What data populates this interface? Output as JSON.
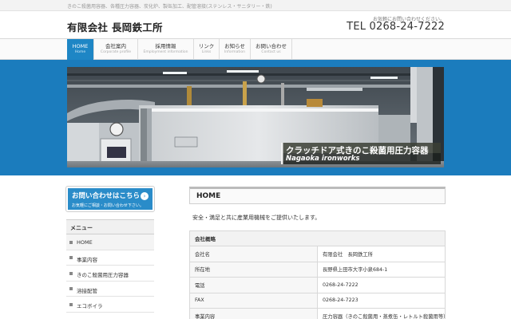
{
  "topbar": {
    "tagline": "きのこ殺菌用容器、各種圧力容器、炭化炉、製缶加工、配管溶接(ステンレス・サニタリー・鉄)"
  },
  "header": {
    "site_title": "有限会社 長岡鉄工所",
    "contact_note": "お気軽にお問い合わせください。",
    "phone": "TEL 0268-24-7222"
  },
  "nav": [
    {
      "jp": "HOME",
      "en": "Home",
      "active": true
    },
    {
      "jp": "会社案内",
      "en": "Corporate profile"
    },
    {
      "jp": "採用情報",
      "en": "Employment information"
    },
    {
      "jp": "リンク",
      "en": "Links"
    },
    {
      "jp": "お知らせ",
      "en": "Information"
    },
    {
      "jp": "お問い合わせ",
      "en": "Contact us"
    }
  ],
  "hero": {
    "caption_jp": "クラッチドア式きのこ殺菌用圧力容器",
    "caption_en": "Nagaoka ironworks"
  },
  "sidebar": {
    "contact_title": "お問い合わせはこちら",
    "contact_sub": "お気軽にご相談・お問い合わせ下さい。",
    "menu_title": "メニュー",
    "menu_items": [
      "HOME",
      "事業内容",
      "きのこ殺菌用圧力容器",
      "溶接配管",
      "エコボイラ"
    ]
  },
  "main": {
    "heading": "HOME",
    "intro": "安全・満足と共に産業用機械をご提供いたします。",
    "table_caption": "会社概略",
    "rows": [
      {
        "label": "会社名",
        "value": "有限会社　長岡鉄工所"
      },
      {
        "label": "所在地",
        "value": "長野県上田市大字小泉684-1"
      },
      {
        "label": "電話",
        "value": "0268-24-7222"
      },
      {
        "label": "FAX",
        "value": "0268-24-7223"
      },
      {
        "label": "事業内容",
        "value": "圧力容器（きのこ殺菌用・蒸煮缶・レトルト殺菌用等）、製缶類（穀物サイロ・貯留タンク）"
      }
    ]
  },
  "colors": {
    "accent": "#1e86c5",
    "band": "#1b7cbd"
  }
}
